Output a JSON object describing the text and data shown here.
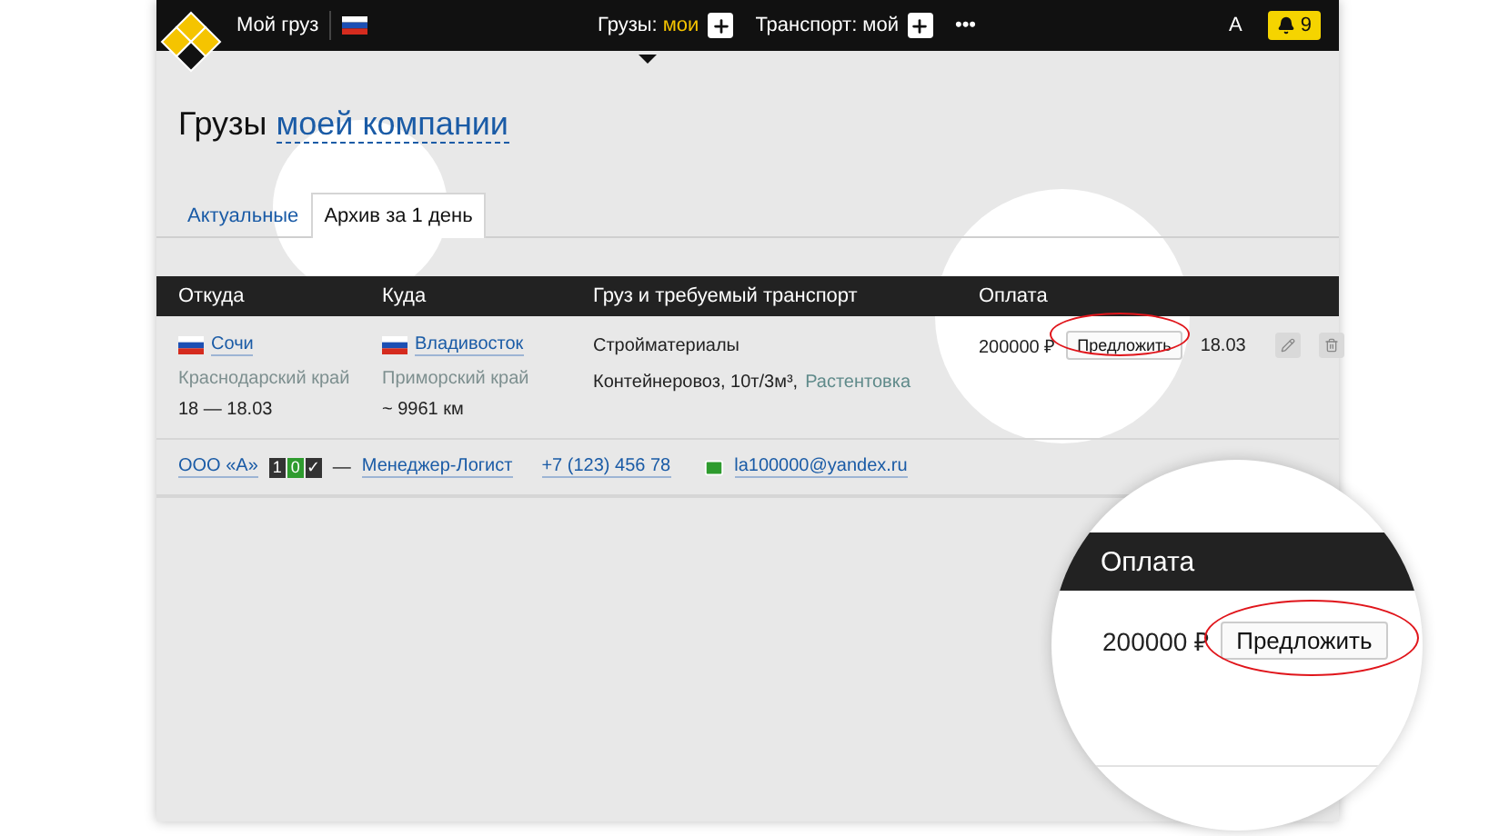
{
  "header": {
    "my_cargo": "Мой груз",
    "menus": [
      {
        "label": "Грузы:",
        "value": "мои",
        "selected": true
      },
      {
        "label": "Транспорт:",
        "value": "мой",
        "selected": false
      }
    ],
    "more": "•••",
    "user": "А",
    "notifications": "9"
  },
  "title": {
    "text": "Грузы",
    "link": "моей компании"
  },
  "tabs": [
    {
      "label": "Актуальные",
      "selected": false
    },
    {
      "label": "Архив за 1 день",
      "selected": true
    }
  ],
  "table": {
    "columns": [
      "Откуда",
      "Куда",
      "Груз и требуемый транспорт",
      "Оплата"
    ],
    "rows": [
      {
        "from": {
          "city": "Сочи",
          "region": "Краснодарский край",
          "dates": "18 — 18.03"
        },
        "to": {
          "city": "Владивосток",
          "region": "Приморский край",
          "distance": "~ 9961 км"
        },
        "cargo": {
          "name": "Стройматериалы",
          "transport": "Контейнеровоз, 10т/3м³,",
          "loading": "Растентовка"
        },
        "payment": {
          "amount": "200000 ₽",
          "action": "Предложить",
          "date": "18.03"
        },
        "contact": {
          "company": "ООО «А»",
          "rating": [
            {
              "text": "1",
              "color": "#333333"
            },
            {
              "text": "0",
              "color": "#2e9b2e"
            },
            {
              "text": "✓",
              "color": "#333333"
            }
          ],
          "dash": "—",
          "person": "Менеджер-Логист",
          "phone": "+7 (123) 456 78",
          "email": "la100000@yandex.ru"
        }
      }
    ]
  },
  "magnifier": {
    "column": "Оплата",
    "amount": "200000 ₽",
    "action": "Предложить"
  }
}
